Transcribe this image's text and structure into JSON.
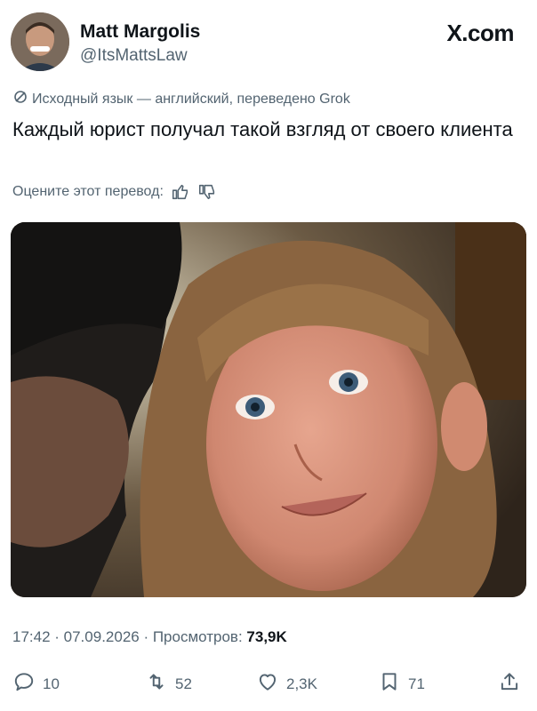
{
  "author": {
    "name": "Matt Margolis",
    "handle": "@ItsMattsLaw"
  },
  "brand": "X.com",
  "translation_note": "Исходный язык — английский, переведено Grok",
  "tweet_text": "Каждый юрист получал такой взгляд от своего клиента",
  "rate_prompt": "Оцените этот перевод:",
  "meta": {
    "time": "17:42 · 07.09.2026 · Просмотров: ",
    "views": "73,9K"
  },
  "actions": {
    "replies": "10",
    "reposts": "52",
    "likes": "2,3K",
    "bookmarks": "71"
  },
  "icons": [
    "translate-icon",
    "thumbs-up-icon",
    "thumbs-down-icon",
    "reply-icon",
    "repost-icon",
    "like-icon",
    "bookmark-icon",
    "share-icon"
  ],
  "colors": {
    "text": "#0f1419",
    "secondary": "#536471"
  }
}
